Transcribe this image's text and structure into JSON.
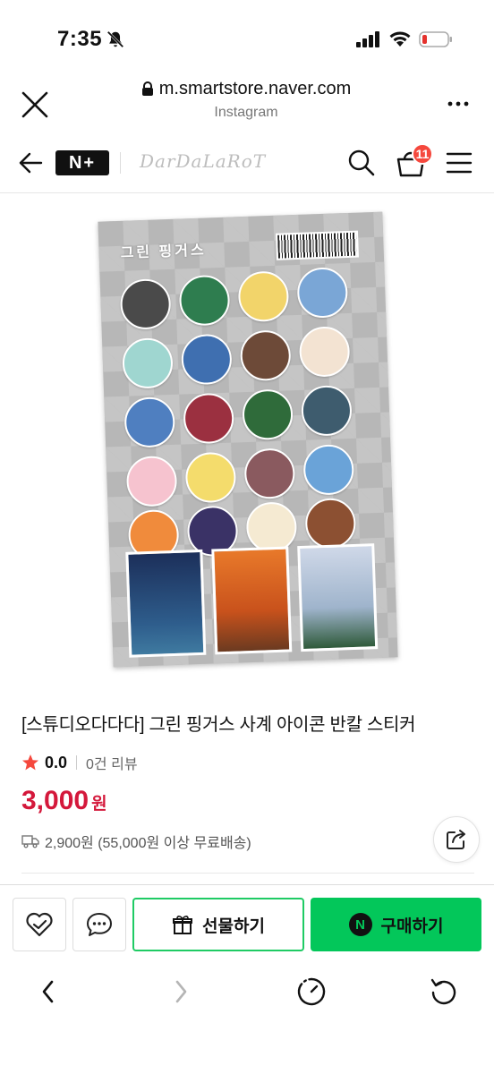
{
  "status_bar": {
    "time": "7:35",
    "icons": [
      "bell-slash-icon",
      "signal-icon",
      "wifi-icon",
      "battery-low-icon"
    ],
    "battery_color": "#e5322d"
  },
  "browser": {
    "url": "m.smartstore.naver.com",
    "source": "Instagram",
    "icons": [
      "close-icon",
      "lock-icon",
      "more-icon"
    ]
  },
  "store_nav": {
    "brand_logo": "N+",
    "store_logo": "DarDaLaRoT",
    "cart_count": "11",
    "icons": [
      "back-arrow-icon",
      "search-icon",
      "cart-icon",
      "menu-icon"
    ]
  },
  "product": {
    "sheet_title": "그린 핑거스",
    "title": "[스튜디오다다다] 그린 핑거스 사계 아이콘 반칼 스티커",
    "rating": "0.0",
    "review_count": "0건 리뷰",
    "price": "3,000",
    "price_unit": "원",
    "shipping": "2,900원 (55,000원 이상 무료배송)",
    "colors": {
      "price": "#d4183b",
      "star": "#f5483d"
    }
  },
  "actions": {
    "gift_label": "선물하기",
    "buy_label": "구매하기",
    "buy_badge": "N",
    "colors": {
      "green": "#03c75a"
    }
  },
  "toolbar": {
    "icons": [
      "back-chevron-icon",
      "forward-chevron-icon",
      "timer-icon",
      "reload-icon"
    ]
  }
}
